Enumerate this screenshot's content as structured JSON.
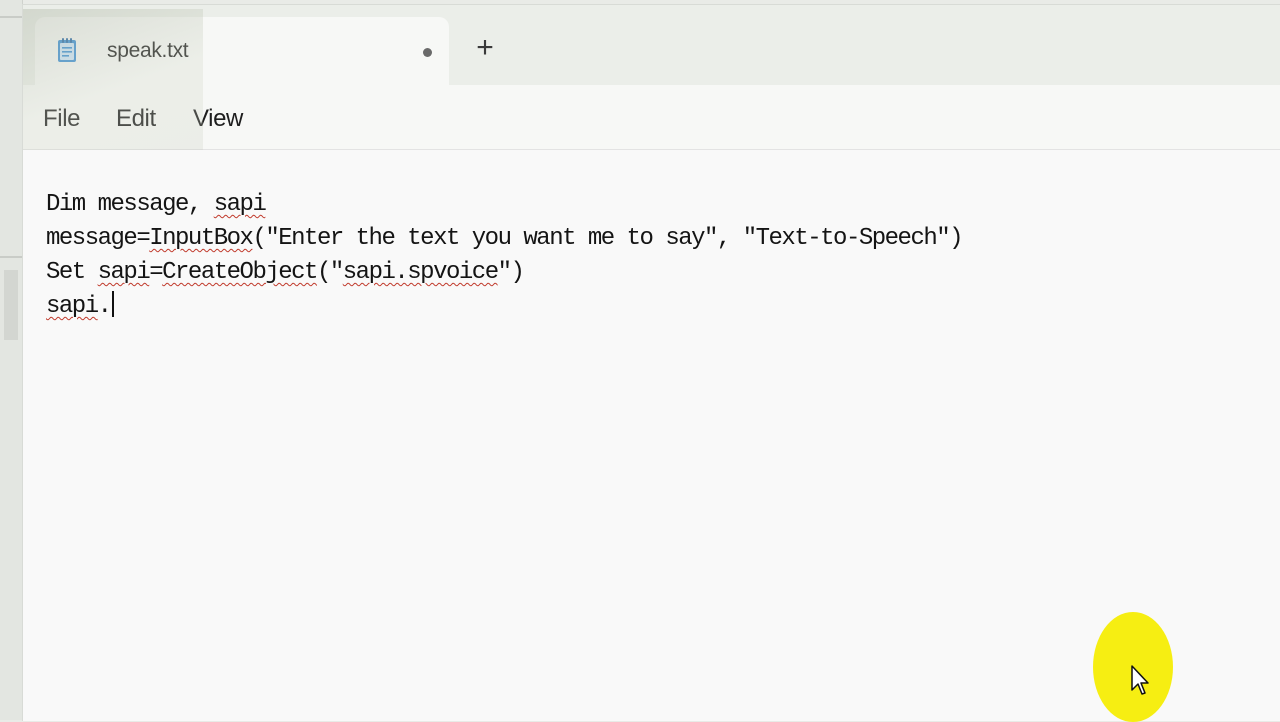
{
  "tab": {
    "title": "speak.txt",
    "icon": "notepad-icon",
    "unsaved_indicator": "●",
    "new_tab_label": "+"
  },
  "menu": {
    "items": [
      "File",
      "Edit",
      "View"
    ]
  },
  "editor": {
    "lines": [
      [
        {
          "t": "Dim message, "
        },
        {
          "t": "sapi",
          "spell": true
        }
      ],
      [
        {
          "t": "message="
        },
        {
          "t": "InputBox",
          "spell": true
        },
        {
          "t": "(\"Enter the text you want me to say\", \"Text-to-Speech\")"
        }
      ],
      [
        {
          "t": "Set "
        },
        {
          "t": "sapi",
          "spell": true
        },
        {
          "t": "="
        },
        {
          "t": "CreateObject",
          "spell": true
        },
        {
          "t": "(\""
        },
        {
          "t": "sapi.spvoice",
          "spell": true
        },
        {
          "t": "\")"
        }
      ],
      [
        {
          "t": "sapi",
          "spell": true
        },
        {
          "t": "."
        }
      ]
    ],
    "caret_line": 3
  },
  "colors": {
    "highlight": "#f6ee12",
    "spellcheck": "#c0392b"
  }
}
